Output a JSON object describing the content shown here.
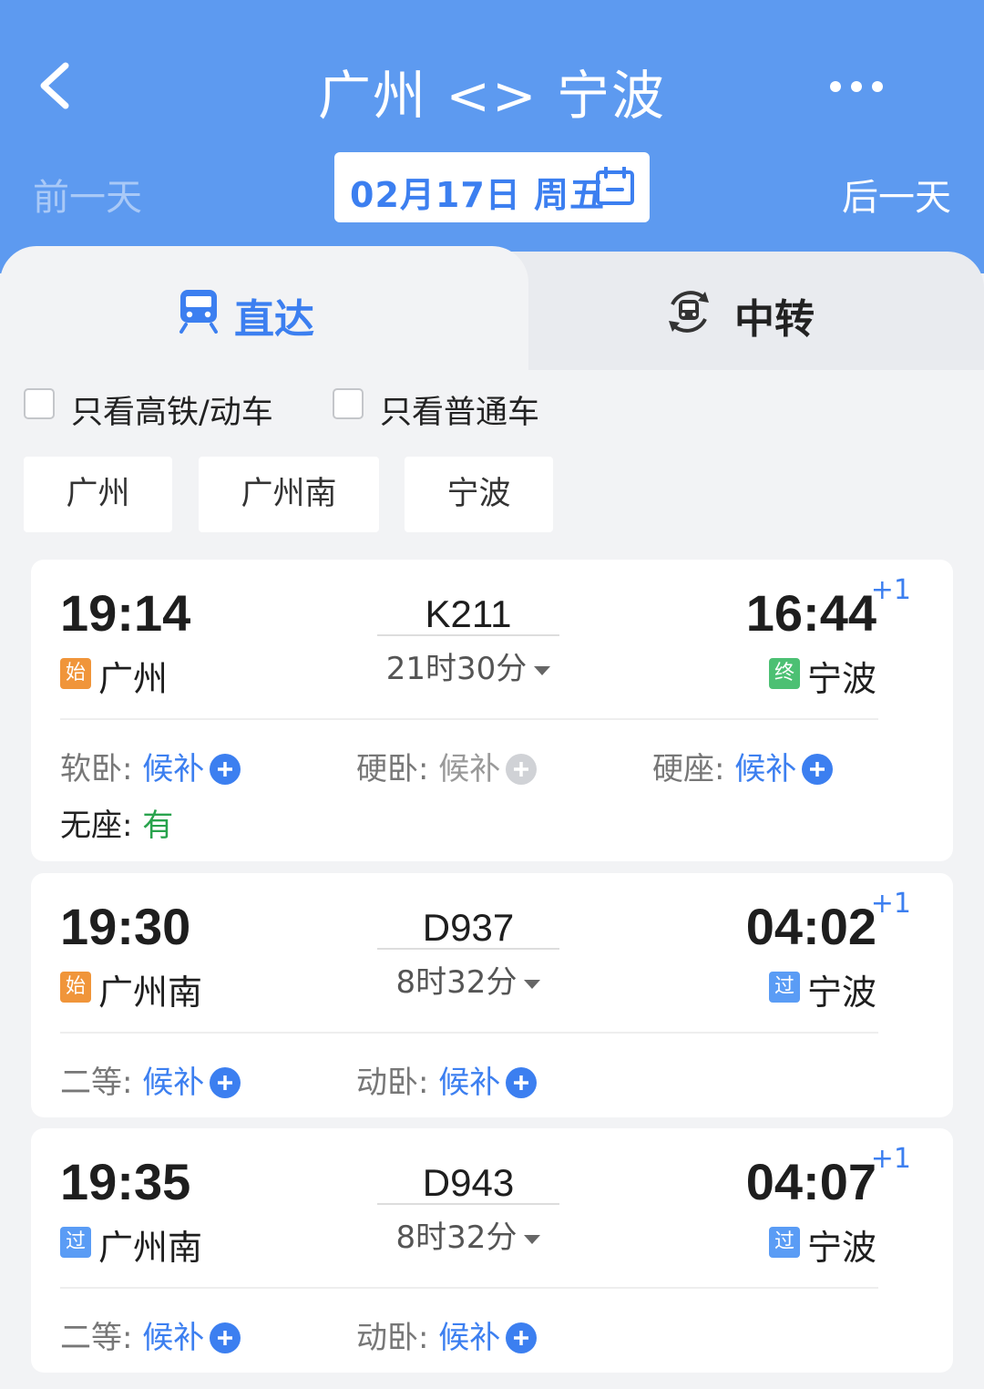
{
  "header": {
    "title": "广州 <> 宁波",
    "prev_day": "前一天",
    "next_day": "后一天",
    "date": "02月17日 周五",
    "back_icon": "chevron-left-icon",
    "more_icon": "more-dots-icon",
    "calendar_icon": "calendar-icon"
  },
  "tabs": [
    {
      "label": "直达",
      "icon": "train-icon",
      "active": true
    },
    {
      "label": "中转",
      "icon": "transfer-icon",
      "active": false
    }
  ],
  "filters": [
    {
      "label": "只看高铁/动车",
      "checked": false
    },
    {
      "label": "只看普通车",
      "checked": false
    }
  ],
  "stations": [
    "广州",
    "广州南",
    "宁波"
  ],
  "colors": {
    "accent": "#3c7ff0",
    "header": "#5d9af0",
    "start_badge": "#f0953a",
    "end_badge": "#4cc073",
    "pass_badge": "#5a9cf5",
    "available": "#29a34d"
  },
  "trains": [
    {
      "dep_time": "19:14",
      "dep_badge": "始",
      "dep_station": "广州",
      "train_no": "K211",
      "duration": "21时30分",
      "arr_time": "16:44",
      "arr_plus": "+1",
      "arr_badge": "终",
      "arr_station": "宁波",
      "seats": [
        {
          "name": "软卧",
          "sep": ": ",
          "status": "候补"
        },
        {
          "name": "硬卧",
          "sep": ": ",
          "status": "候补"
        },
        {
          "name": "硬座",
          "sep": ": ",
          "status": "候补"
        },
        {
          "name": "无座",
          "sep": ": ",
          "status": "有"
        }
      ]
    },
    {
      "dep_time": "19:30",
      "dep_badge": "始",
      "dep_station": "广州南",
      "train_no": "D937",
      "duration": "8时32分",
      "arr_time": "04:02",
      "arr_plus": "+1",
      "arr_badge": "过",
      "arr_station": "宁波",
      "seats": [
        {
          "name": "二等",
          "sep": ": ",
          "status": "候补"
        },
        {
          "name": "动卧",
          "sep": ": ",
          "status": "候补"
        }
      ]
    },
    {
      "dep_time": "19:35",
      "dep_badge": "过",
      "dep_station": "广州南",
      "train_no": "D943",
      "duration": "8时32分",
      "arr_time": "04:07",
      "arr_plus": "+1",
      "arr_badge": "过",
      "arr_station": "宁波",
      "seats": [
        {
          "name": "二等",
          "sep": ": ",
          "status": "候补"
        },
        {
          "name": "动卧",
          "sep": ": ",
          "status": "候补"
        }
      ]
    }
  ]
}
